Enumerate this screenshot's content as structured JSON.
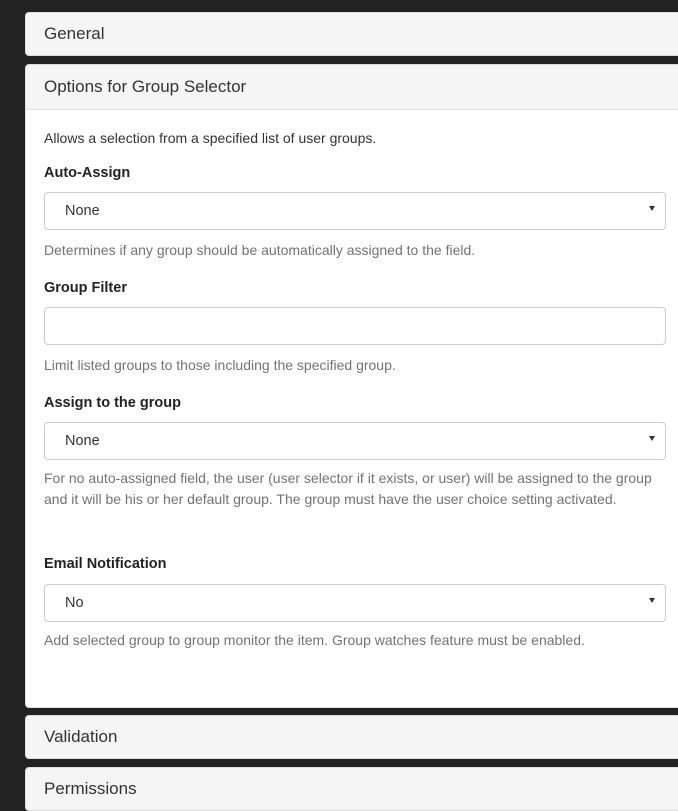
{
  "panels": {
    "general": "General",
    "options": "Options for Group Selector",
    "validation": "Validation",
    "permissions": "Permissions"
  },
  "options": {
    "description": "Allows a selection from a specified list of user groups.",
    "auto_assign": {
      "label": "Auto-Assign",
      "value": "None",
      "help": "Determines if any group should be automatically assigned to the field."
    },
    "group_filter": {
      "label": "Group Filter",
      "value": "",
      "help": "Limit listed groups to those including the specified group."
    },
    "assign_group": {
      "label": "Assign to the group",
      "value": "None",
      "help": "For no auto-assigned field, the user (user selector if it exists, or user) will be assigned to the group and it will be his or her default group. The group must have the user choice setting activated."
    },
    "email_notification": {
      "label": "Email Notification",
      "value": "No",
      "help": "Add selected group to group monitor the item. Group watches feature must be enabled."
    }
  },
  "icons": {
    "select_caret": "caret-down-icon"
  }
}
